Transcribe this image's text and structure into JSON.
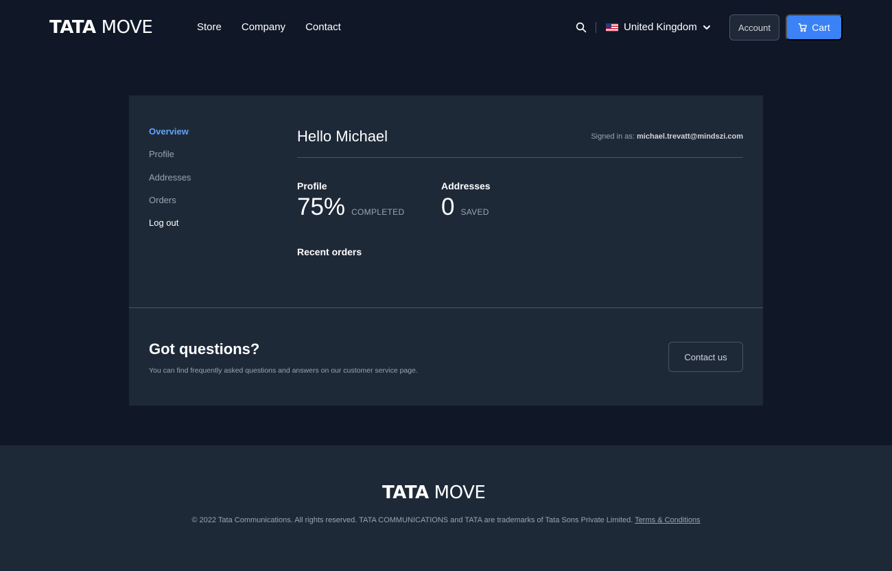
{
  "brand": {
    "logo_bold": "TATA",
    "logo_light": "MOVE"
  },
  "nav": {
    "items": [
      "Store",
      "Company",
      "Contact"
    ]
  },
  "header": {
    "country": "United Kingdom",
    "account_label": "Account",
    "cart_label": "Cart"
  },
  "sidebar": {
    "items": [
      "Overview",
      "Profile",
      "Addresses",
      "Orders",
      "Log out"
    ]
  },
  "overview": {
    "greeting": "Hello Michael",
    "signed_in_label": "Signed in as:",
    "signed_in_email": "michael.trevatt@mindszi.com",
    "profile": {
      "label": "Profile",
      "value": "75%",
      "unit": "COMPLETED"
    },
    "addresses": {
      "label": "Addresses",
      "value": "0",
      "unit": "SAVED"
    },
    "recent_orders_label": "Recent orders"
  },
  "questions": {
    "title": "Got questions?",
    "text": "You can find frequently asked questions and answers on our customer service page.",
    "button": "Contact us"
  },
  "footer": {
    "copyright": "© 2022 Tata Communications. All rights reserved. TATA COMMUNICATIONS and TATA are trademarks of Tata Sons Private Limited.",
    "terms_link": "Terms & Conditions"
  },
  "colors": {
    "background": "#101828",
    "card": "#1e2938",
    "accent": "#3b82f6",
    "active_link": "#60a5fa"
  }
}
